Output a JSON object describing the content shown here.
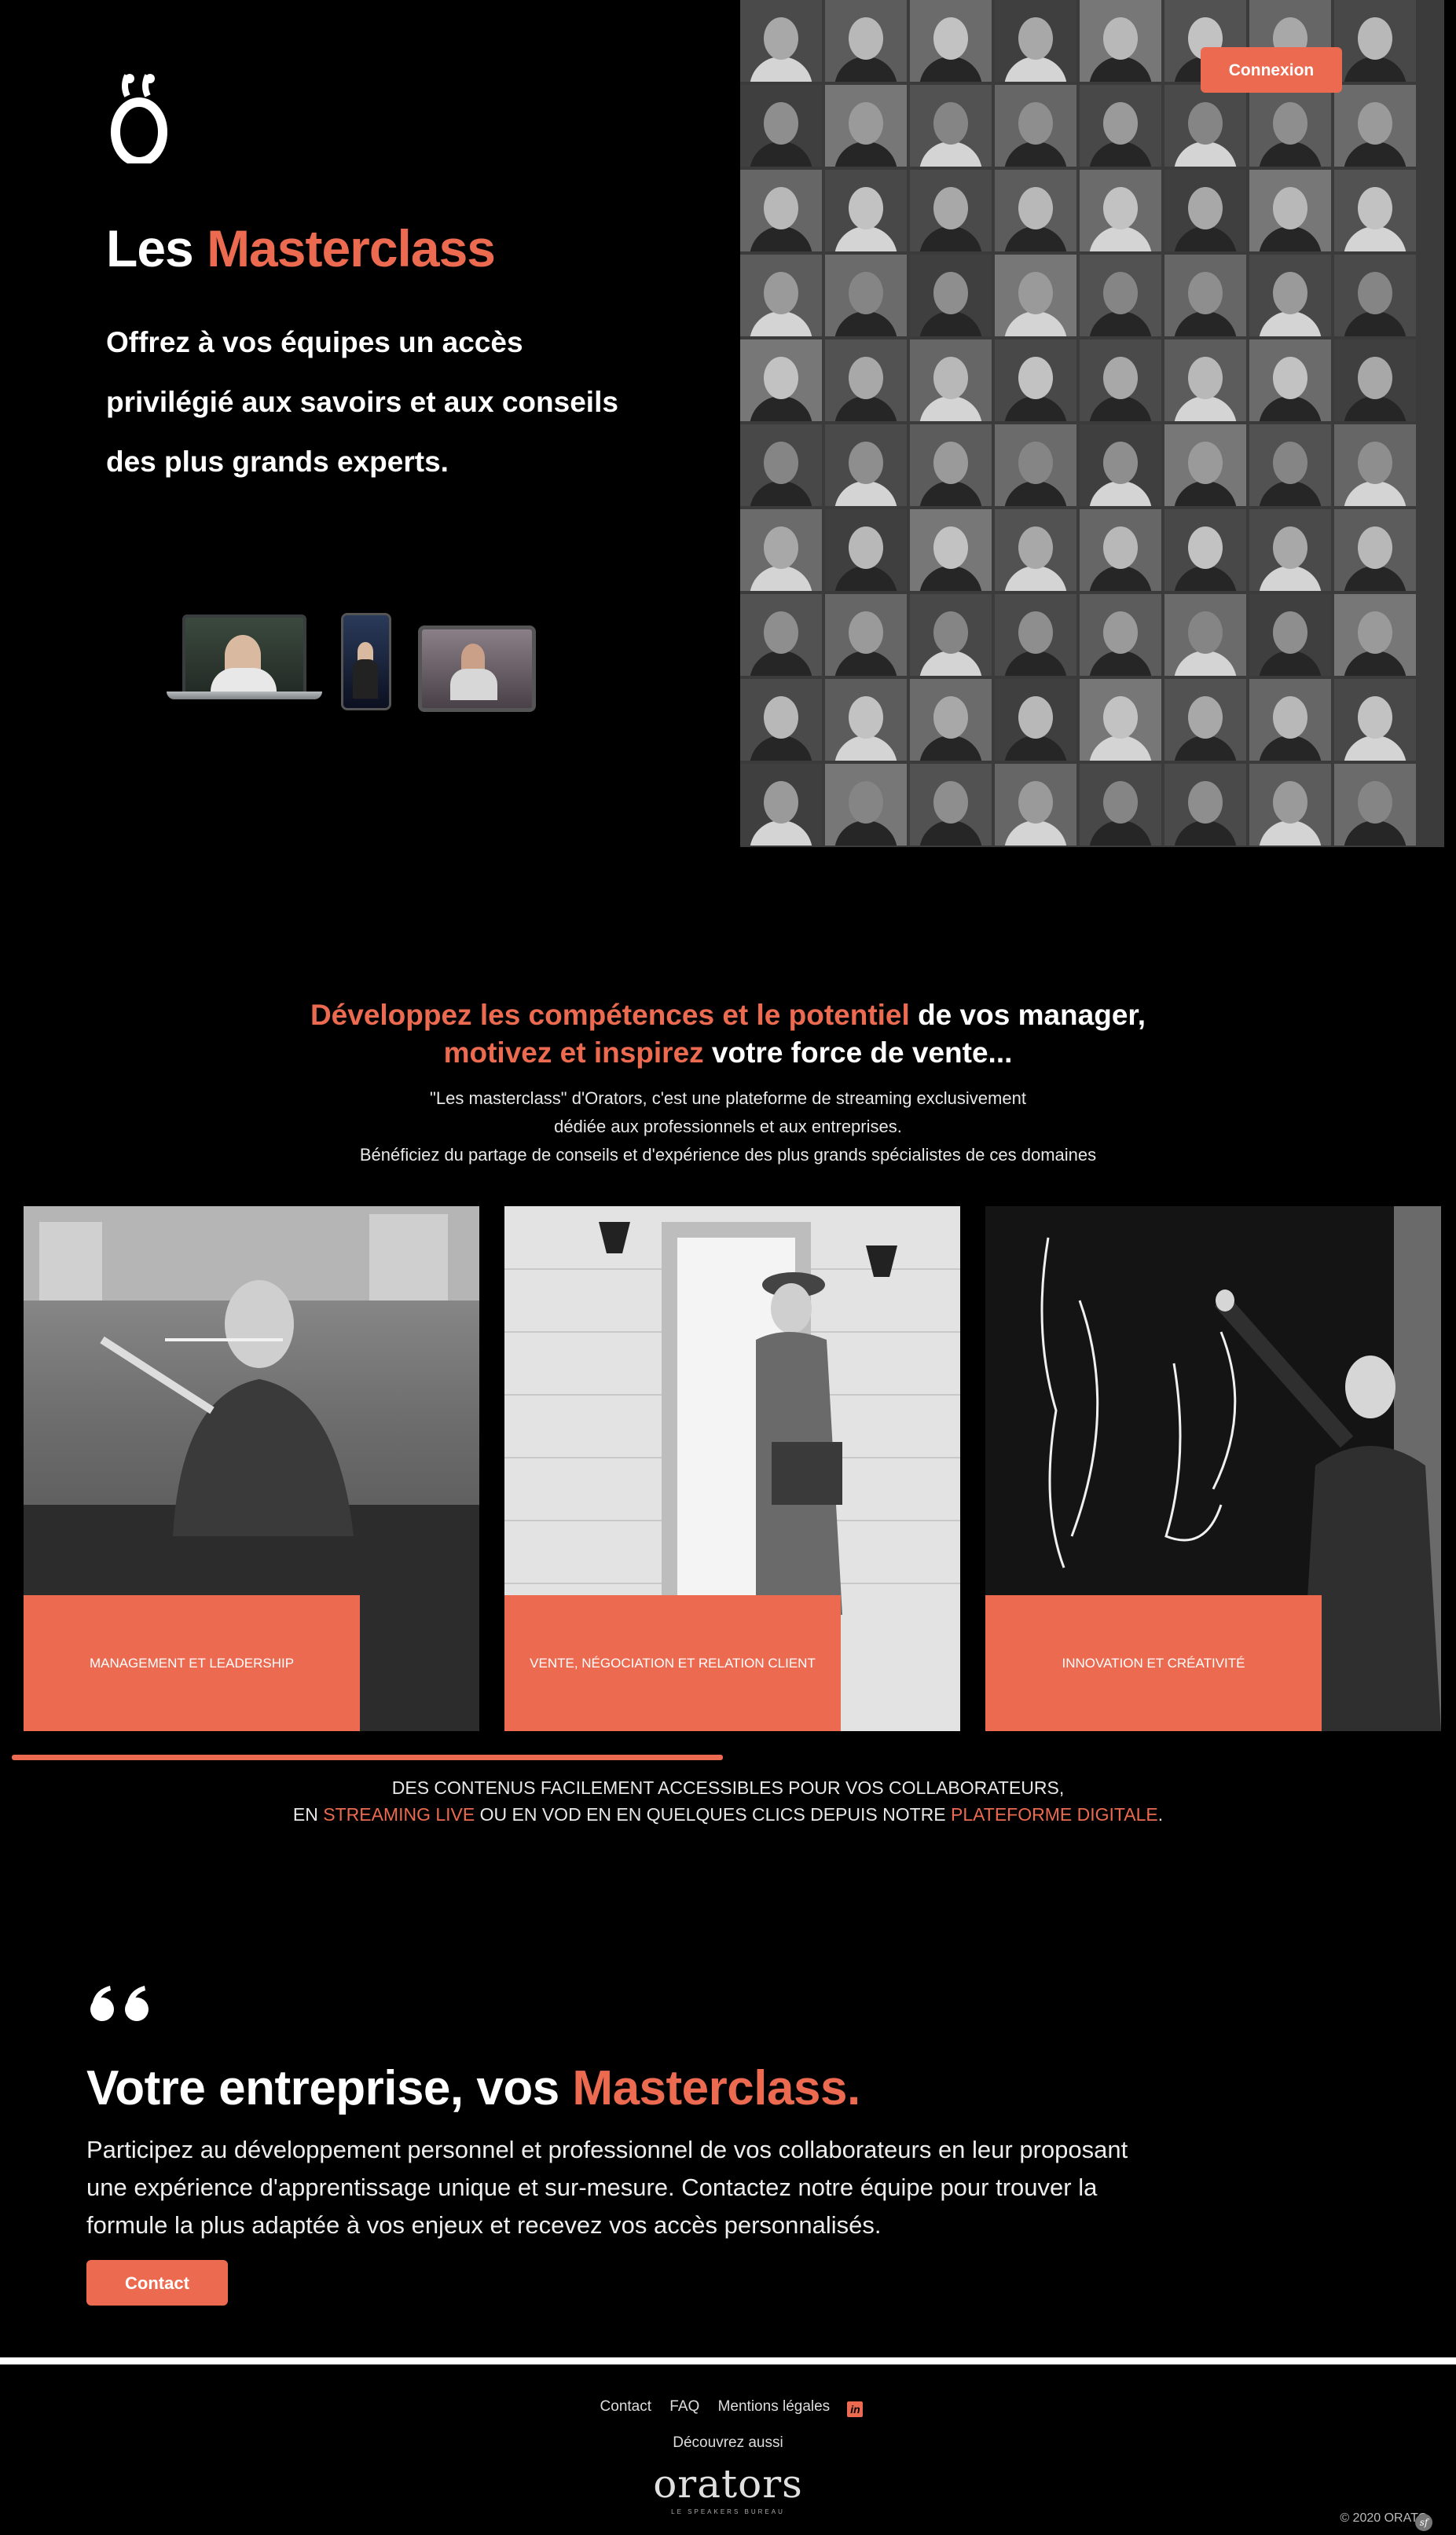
{
  "header": {
    "connexion_label": "Connexion"
  },
  "hero": {
    "title_prefix": "Les ",
    "title_accent": "Masterclass",
    "lead": "Offrez à vos équipes un accès privilégié aux savoirs et aux conseils des plus grands experts."
  },
  "intro": {
    "line1_accent": "Développez les compétences et le potentiel",
    "line1_rest": " de vos manager,",
    "line2_accent": "motivez et inspirez",
    "line2_rest": " votre force de vente...",
    "body_line1": "\"Les masterclass\" d'Orators, c'est une plateforme de streaming exclusivement",
    "body_line2": "dédiée aux professionnels et aux entreprises.",
    "body_line3": "Bénéficiez du partage de conseils et d'expérience des plus grands spécialistes de ces domaines"
  },
  "categories": [
    {
      "label": "MANAGEMENT ET LEADERSHIP"
    },
    {
      "label": "VENTE, NÉGOCIATION ET RELATION CLIENT"
    },
    {
      "label": "INNOVATION ET CRÉATIVITÉ"
    }
  ],
  "carousel": {
    "progress": 0.5
  },
  "streaming": {
    "line1": "DES CONTENUS FACILEMENT ACCESSIBLES POUR VOS COLLABORATEURS,",
    "line2_a": "EN ",
    "line2_accent1": "STREAMING LIVE",
    "line2_b": " OU EN VOD EN EN QUELQUES CLICS DEPUIS NOTRE ",
    "line2_accent2": "PLATEFORME DIGITALE",
    "line2_c": "."
  },
  "cta": {
    "title_prefix": "Votre entreprise, vos ",
    "title_accent": "Masterclass.",
    "body": "Participez au développement personnel et professionnel de vos collaborateurs en leur proposant une expérience d'apprentissage unique et sur-mesure. Contactez notre équipe pour trouver la formule la plus adaptée à vos enjeux et recevez vos accès personnalisés.",
    "button_label": "Contact"
  },
  "footer": {
    "links": [
      "Contact",
      "FAQ",
      "Mentions légales"
    ],
    "linkedin_icon": "linkedin-icon",
    "discover": "Découvrez aussi",
    "brand": "orators",
    "brand_sub": "LE SPEAKERS BUREAU",
    "copyright": "© 2020 ORATO"
  },
  "colors": {
    "accent": "#ec6a50",
    "background": "#000000"
  }
}
